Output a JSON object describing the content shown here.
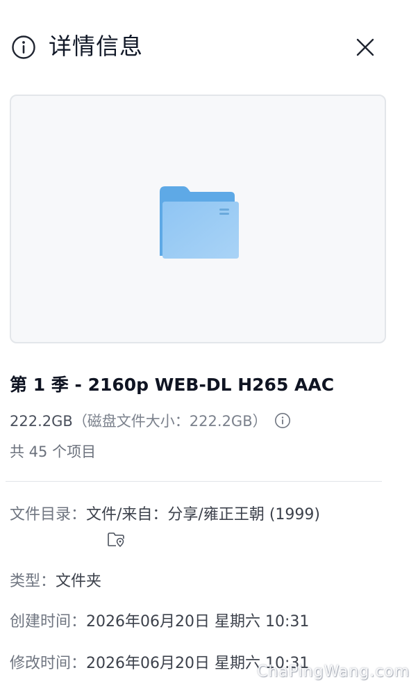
{
  "header": {
    "title": "详情信息",
    "info_icon": "info-circle-icon",
    "close_icon": "close-icon"
  },
  "preview": {
    "icon": "folder-icon"
  },
  "item": {
    "name": "第 1 季 - 2160p WEB-DL H265 AAC",
    "size": "222.2GB",
    "disk_size_note": "（磁盘文件大小：222.2GB）",
    "count": "共 45 个项目"
  },
  "details": {
    "directory_label": "文件目录：",
    "directory_value": "文件/来自：分享/雍正王朝 (1999)",
    "type_label": "类型：",
    "type_value": "文件夹",
    "created_label": "创建时间：",
    "created_value": "2026年06月20日 星期六 10:31",
    "modified_label": "修改时间：",
    "modified_value": "2026年06月20日 星期六 10:31"
  },
  "watermark": "ChaPingWang.com",
  "colors": {
    "folder_back": "#5aa8e8",
    "folder_front": "#8cc6f4",
    "preview_bg": "#f7f8fa",
    "border": "#e3e6ea"
  }
}
